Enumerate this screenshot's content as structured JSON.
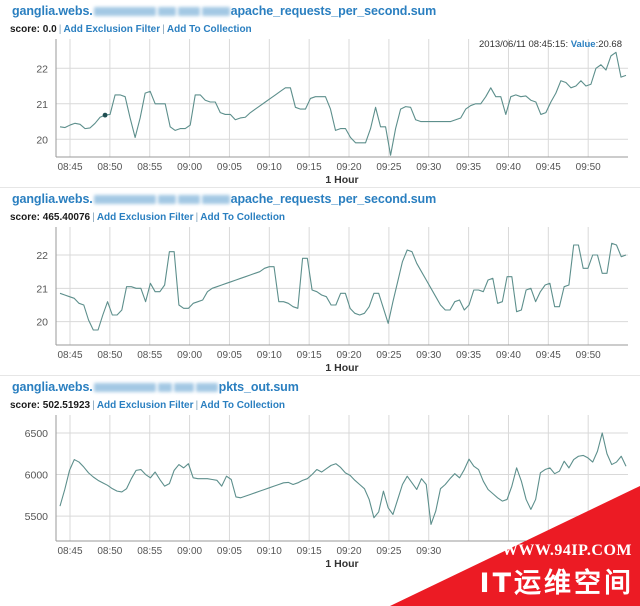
{
  "page": {
    "background": "#ffffff",
    "accent": "#2a7fc0",
    "line_color": "#5d8f8c",
    "grid_color": "#d9d9d9",
    "axis_color": "#9a9a9a"
  },
  "watermark": {
    "url_text": "WWW.94IP.COM",
    "brand_text": "IT运维空间",
    "color": "#ec1b24"
  },
  "panels": [
    {
      "title_prefix": "ganglia.webs.",
      "title_suffix": "apache_requests_per_second.sum",
      "redacted_widths": [
        62,
        18,
        22,
        28
      ],
      "score_label": "score: 0.0",
      "links": [
        "Add Exclusion Filter",
        "Add To Collection"
      ],
      "separator": "|",
      "tooltip": {
        "timestamp": "2013/06/11 08:45:15:",
        "value_key": "Value",
        "value_sep": ":",
        "value": "20.68"
      },
      "chart_data": {
        "type": "line",
        "title": "ganglia.webs.apache_requests_per_second.sum",
        "xlabel": "1 Hour",
        "ylabel": "",
        "ylim": [
          19.5,
          22.6
        ],
        "yticks": [
          20,
          21,
          22
        ],
        "xticks": [
          "08:45",
          "08:50",
          "08:55",
          "09:00",
          "09:05",
          "09:10",
          "09:15",
          "09:20",
          "09:25",
          "09:30",
          "09:35",
          "09:40",
          "09:45",
          "09:50"
        ],
        "grid": true,
        "legend": "none",
        "values": [
          20.35,
          20.33,
          20.4,
          20.45,
          20.42,
          20.3,
          20.32,
          20.45,
          20.62,
          20.68,
          20.7,
          21.25,
          21.25,
          21.2,
          20.6,
          20.05,
          20.6,
          21.3,
          21.35,
          21.0,
          21.0,
          21.0,
          20.35,
          20.25,
          20.3,
          20.3,
          20.4,
          21.25,
          21.25,
          21.1,
          21.05,
          21.05,
          20.75,
          20.7,
          20.7,
          20.55,
          20.6,
          20.62,
          20.75,
          20.85,
          20.95,
          21.05,
          21.15,
          21.25,
          21.35,
          21.45,
          21.45,
          20.9,
          20.85,
          20.85,
          21.15,
          21.2,
          21.2,
          21.2,
          20.85,
          20.25,
          20.3,
          20.3,
          20.05,
          19.9,
          19.9,
          19.9,
          20.3,
          20.9,
          20.35,
          20.35,
          19.55,
          20.3,
          20.85,
          20.92,
          20.9,
          20.55,
          20.5,
          20.5,
          20.5,
          20.5,
          20.5,
          20.5,
          20.5,
          20.55,
          20.6,
          20.85,
          20.95,
          21.0,
          21.0,
          21.2,
          21.45,
          21.2,
          21.2,
          20.7,
          21.2,
          21.25,
          21.2,
          21.22,
          21.1,
          21.05,
          20.7,
          20.75,
          21.05,
          21.3,
          21.65,
          21.6,
          21.45,
          21.5,
          21.65,
          21.5,
          21.55,
          22.0,
          22.1,
          21.95,
          22.35,
          22.45,
          21.75,
          21.8
        ]
      }
    },
    {
      "title_prefix": "ganglia.webs.",
      "title_suffix": "apache_requests_per_second.sum",
      "redacted_widths": [
        62,
        18,
        22,
        28
      ],
      "score_label": "score: 465.40076",
      "links": [
        "Add Exclusion Filter",
        "Add To Collection"
      ],
      "separator": "|",
      "tooltip": null,
      "chart_data": {
        "type": "line",
        "title": "ganglia.webs.apache_requests_per_second.sum",
        "xlabel": "1 Hour",
        "ylabel": "",
        "ylim": [
          19.3,
          22.6
        ],
        "yticks": [
          20,
          21,
          22
        ],
        "xticks": [
          "08:45",
          "08:50",
          "08:55",
          "09:00",
          "09:05",
          "09:10",
          "09:15",
          "09:20",
          "09:25",
          "09:30",
          "09:35",
          "09:40",
          "09:45",
          "09:50"
        ],
        "grid": true,
        "legend": "none",
        "values": [
          20.85,
          20.8,
          20.75,
          20.7,
          20.55,
          20.5,
          20.05,
          19.75,
          19.75,
          20.2,
          20.6,
          20.2,
          20.2,
          20.35,
          21.05,
          21.05,
          21.0,
          21.0,
          20.6,
          21.15,
          20.9,
          20.9,
          21.1,
          22.1,
          22.1,
          20.5,
          20.4,
          20.4,
          20.55,
          20.6,
          20.65,
          20.9,
          21.0,
          21.05,
          21.1,
          21.15,
          21.2,
          21.25,
          21.3,
          21.35,
          21.4,
          21.45,
          21.5,
          21.6,
          21.65,
          21.65,
          20.6,
          20.6,
          20.55,
          20.45,
          20.4,
          21.9,
          21.9,
          20.95,
          20.9,
          20.8,
          20.75,
          20.5,
          20.5,
          20.85,
          20.85,
          20.4,
          20.25,
          20.2,
          20.25,
          20.45,
          20.85,
          20.85,
          20.4,
          19.95,
          20.6,
          21.2,
          21.8,
          22.15,
          22.1,
          21.75,
          21.5,
          21.25,
          21.0,
          20.75,
          20.5,
          20.35,
          20.35,
          20.6,
          20.65,
          20.35,
          20.5,
          20.95,
          20.95,
          20.9,
          21.25,
          21.3,
          20.55,
          20.6,
          21.35,
          21.35,
          20.3,
          20.35,
          20.95,
          21.0,
          20.6,
          20.9,
          21.1,
          21.15,
          20.45,
          20.45,
          21.05,
          21.1,
          22.3,
          22.3,
          21.6,
          21.6,
          22.0,
          22.0,
          21.45,
          21.45,
          22.35,
          22.3,
          21.95,
          22.0
        ]
      }
    },
    {
      "title_prefix": "ganglia.webs.",
      "title_suffix": "pkts_out.sum",
      "redacted_widths": [
        62,
        14,
        20,
        22
      ],
      "score_label": "score: 502.51923",
      "links": [
        "Add Exclusion Filter",
        "Add To Collection"
      ],
      "separator": "|",
      "tooltip": null,
      "chart_data": {
        "type": "line",
        "title": "ganglia.webs.pkts_out.sum",
        "xlabel": "1 Hour",
        "ylabel": "",
        "ylim": [
          5200,
          6620
        ],
        "yticks": [
          5500,
          6000,
          6500
        ],
        "xticks": [
          "08:45",
          "08:50",
          "08:55",
          "09:00",
          "09:05",
          "09:10",
          "09:15",
          "09:20",
          "09:25",
          "09:30"
        ],
        "grid": true,
        "legend": "none",
        "values": [
          5620,
          5820,
          6050,
          6180,
          6150,
          6090,
          6020,
          5970,
          5930,
          5900,
          5870,
          5830,
          5800,
          5790,
          5830,
          5950,
          6050,
          6060,
          6000,
          5960,
          6030,
          5940,
          5860,
          5890,
          6050,
          6120,
          6080,
          6130,
          5960,
          5950,
          5950,
          5950,
          5940,
          5930,
          5860,
          5980,
          5940,
          5730,
          5720,
          5740,
          5760,
          5780,
          5800,
          5820,
          5840,
          5860,
          5880,
          5900,
          5905,
          5880,
          5900,
          5930,
          5950,
          6000,
          6060,
          6030,
          6070,
          6110,
          6130,
          6085,
          6020,
          5990,
          5930,
          5880,
          5830,
          5700,
          5480,
          5550,
          5800,
          5600,
          5520,
          5700,
          5880,
          5980,
          5900,
          5820,
          5950,
          5880,
          5400,
          5560,
          5830,
          5880,
          5950,
          6010,
          5960,
          6060,
          6185,
          6100,
          6060,
          5920,
          5820,
          5770,
          5720,
          5680,
          5700,
          5860,
          6080,
          5920,
          5700,
          5580,
          5700,
          6020,
          6060,
          6080,
          6010,
          6040,
          6160,
          6080,
          6180,
          6220,
          6230,
          6200,
          6150,
          6280,
          6500,
          6250,
          6120,
          6150,
          6220,
          6100
        ]
      }
    }
  ]
}
